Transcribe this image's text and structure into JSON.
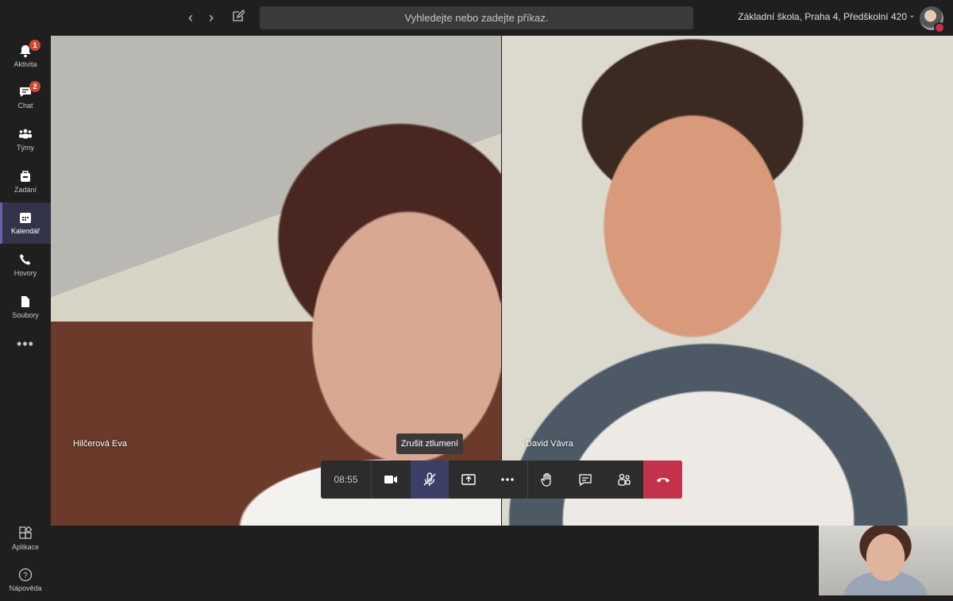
{
  "header": {
    "search_placeholder": "Vyhledejte nebo zadejte příkaz.",
    "organization": "Základní škola, Praha 4, Předškolní 420"
  },
  "rail": {
    "items": [
      {
        "label": "Aktivita",
        "icon": "bell-icon",
        "badge": "1"
      },
      {
        "label": "Chat",
        "icon": "chat-icon",
        "badge": "2"
      },
      {
        "label": "Týmy",
        "icon": "teams-icon"
      },
      {
        "label": "Zadání",
        "icon": "assignments-icon"
      },
      {
        "label": "Kalendář",
        "icon": "calendar-icon",
        "active": true
      },
      {
        "label": "Hovory",
        "icon": "phone-icon"
      },
      {
        "label": "Soubory",
        "icon": "file-icon"
      }
    ],
    "more": "•••",
    "bottom": [
      {
        "label": "Aplikace",
        "icon": "apps-icon"
      },
      {
        "label": "Nápověda",
        "icon": "help-icon"
      }
    ]
  },
  "call": {
    "participants": [
      {
        "name": "Hilčerová Eva"
      },
      {
        "name": "David Vávra"
      }
    ],
    "timer": "08:55",
    "tooltip": "Zrušit ztlumení",
    "controls": [
      {
        "name": "video-camera-icon"
      },
      {
        "name": "microphone-muted-icon"
      },
      {
        "name": "share-screen-icon"
      },
      {
        "name": "more-options-icon"
      },
      {
        "name": "raise-hand-icon"
      },
      {
        "name": "chat-icon"
      },
      {
        "name": "participants-icon"
      },
      {
        "name": "hang-up-icon"
      }
    ]
  },
  "colors": {
    "background": "#201f1f",
    "active_accent": "#6264a7",
    "hangup": "#c4314b",
    "badge": "#cc4a31"
  }
}
